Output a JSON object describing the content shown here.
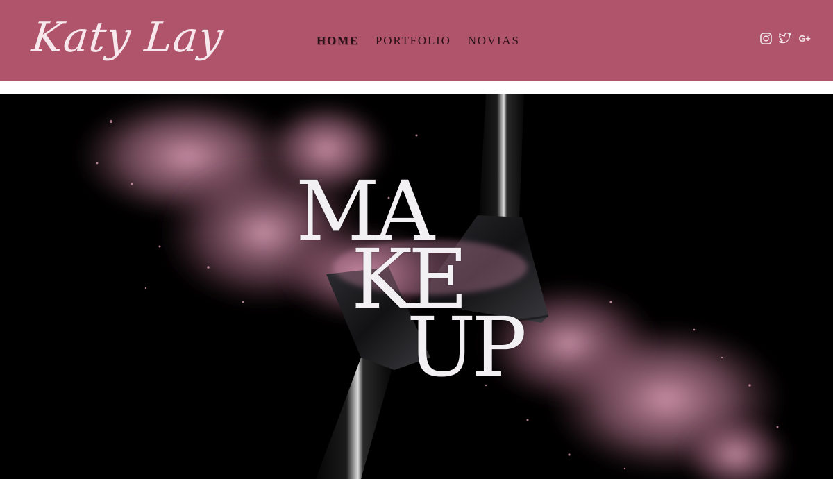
{
  "brand": {
    "logo_text": "Katy Lay",
    "header_color": "#b0546c"
  },
  "nav": {
    "items": [
      {
        "label": "HOME",
        "active": true
      },
      {
        "label": "PORTFOLIO",
        "active": false
      },
      {
        "label": "NOVIAS",
        "active": false
      }
    ]
  },
  "social": {
    "icons": [
      "instagram-icon",
      "twitter-icon",
      "google-plus-icon"
    ],
    "google_plus_label": "G+"
  },
  "hero": {
    "lines": [
      "MA",
      "KE",
      "UP"
    ],
    "background": "#000000",
    "powder_color": "#d48fa8"
  }
}
